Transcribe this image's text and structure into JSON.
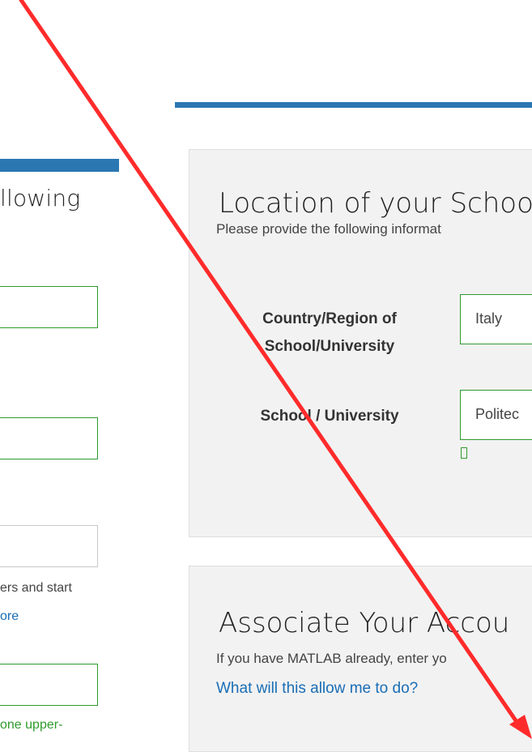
{
  "left_form": {
    "heading_fragment": "llowing",
    "password_hint_line1": "ers and start",
    "password_hint_link": "ore",
    "password_ok_text": "one upper-"
  },
  "location_card": {
    "title": "Location of your Schoo",
    "subtitle": "Please provide the following informat",
    "country_label": "Country/Region of School/University",
    "country_value": "Italy",
    "school_label": "School / University",
    "school_value": "Politec"
  },
  "associate_card": {
    "title": "Associate Your Accou",
    "subtitle": "If you have MATLAB already, enter yo",
    "help_link": "What will this allow me to do?"
  },
  "annotation": {
    "arrow_color": "#ff2b2b"
  }
}
